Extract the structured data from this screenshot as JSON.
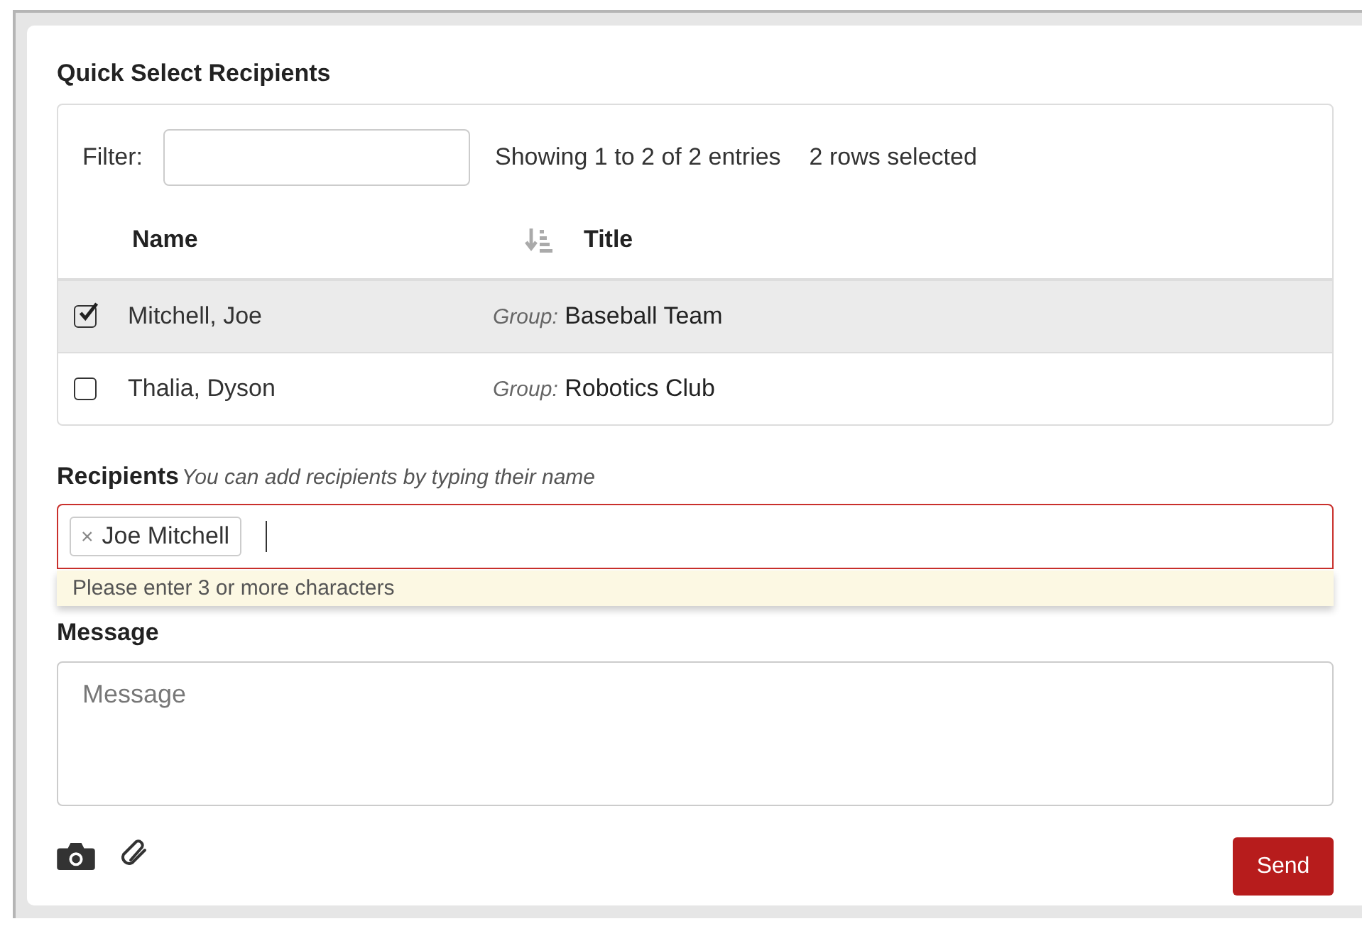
{
  "title": "Quick Select Recipients",
  "filter": {
    "label": "Filter:"
  },
  "info": "Showing 1 to 2 of 2 entries",
  "selection_info": "2 rows selected",
  "columns": [
    "Name",
    "Title"
  ],
  "rows": [
    {
      "name": "Mitchell, Joe",
      "group_label": "Group:",
      "group": "Baseball Team",
      "selected": true
    },
    {
      "name": "Thalia, Dyson",
      "group_label": "Group:",
      "group": "Robotics Club",
      "selected": false
    }
  ],
  "recipients": {
    "label": "Recipients",
    "hint": "You can add recipients by typing their name",
    "tokens": [
      "Joe Mitchell"
    ],
    "token_remove": "×",
    "error": true,
    "dropdown": "Please enter 3 or more characters"
  },
  "message": {
    "label": "Message",
    "placeholder": "Message"
  },
  "send_button": "Send"
}
